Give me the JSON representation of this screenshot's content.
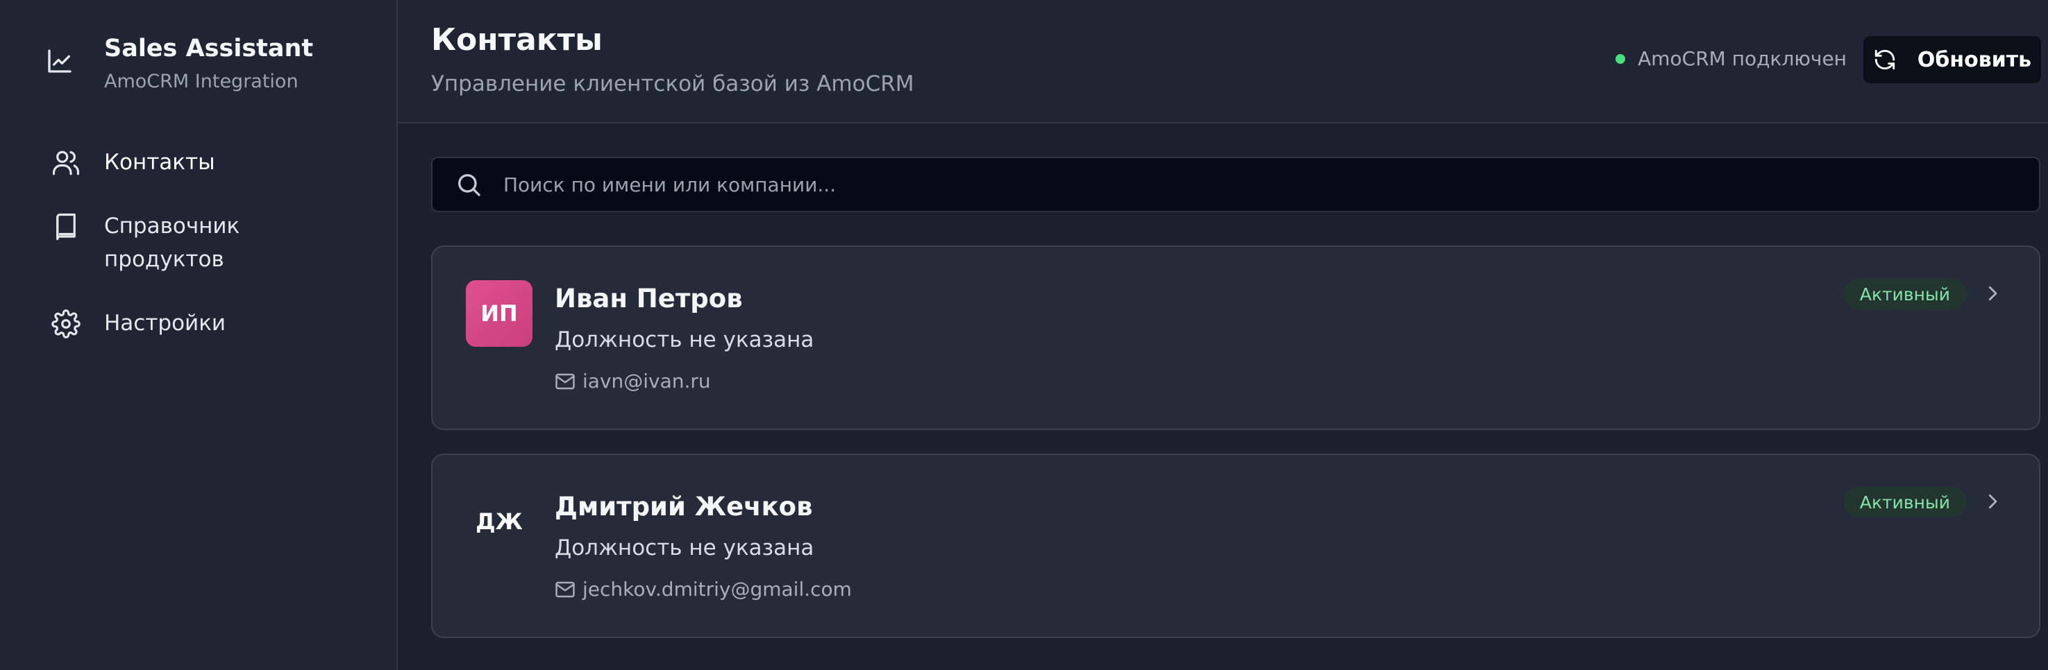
{
  "sidebar": {
    "brand": {
      "title": "Sales Assistant",
      "subtitle": "AmoCRM Integration",
      "icon": "line-chart-icon"
    },
    "items": [
      {
        "label": "Контакты",
        "icon": "users-icon",
        "active": true
      },
      {
        "label": "Справочник продуктов",
        "icon": "book-icon",
        "active": false
      },
      {
        "label": "Настройки",
        "icon": "gear-icon",
        "active": false
      }
    ]
  },
  "header": {
    "title": "Контакты",
    "subtitle": "Управление клиентской базой из AmoCRM",
    "status": {
      "text": "AmoCRM подключен",
      "color": "#4ade80"
    },
    "refresh_label": "Обновить"
  },
  "search": {
    "placeholder": "Поиск по имени или компании...",
    "value": ""
  },
  "contacts": [
    {
      "initials": "ИП",
      "name": "Иван Петров",
      "role": "Должность не указана",
      "email": "iavn@ivan.ru",
      "status": "Активный",
      "avatar_color": "#d9488a"
    },
    {
      "initials": "ДЖ",
      "name": "Дмитрий Жечков",
      "role": "Должность не указана",
      "email": "jechkov.dmitriy@gmail.com",
      "status": "Активный",
      "avatar_color": ""
    }
  ],
  "colors": {
    "accent_green": "#4ade80",
    "badge_text": "#86e3a8",
    "background": "#1b202c"
  }
}
